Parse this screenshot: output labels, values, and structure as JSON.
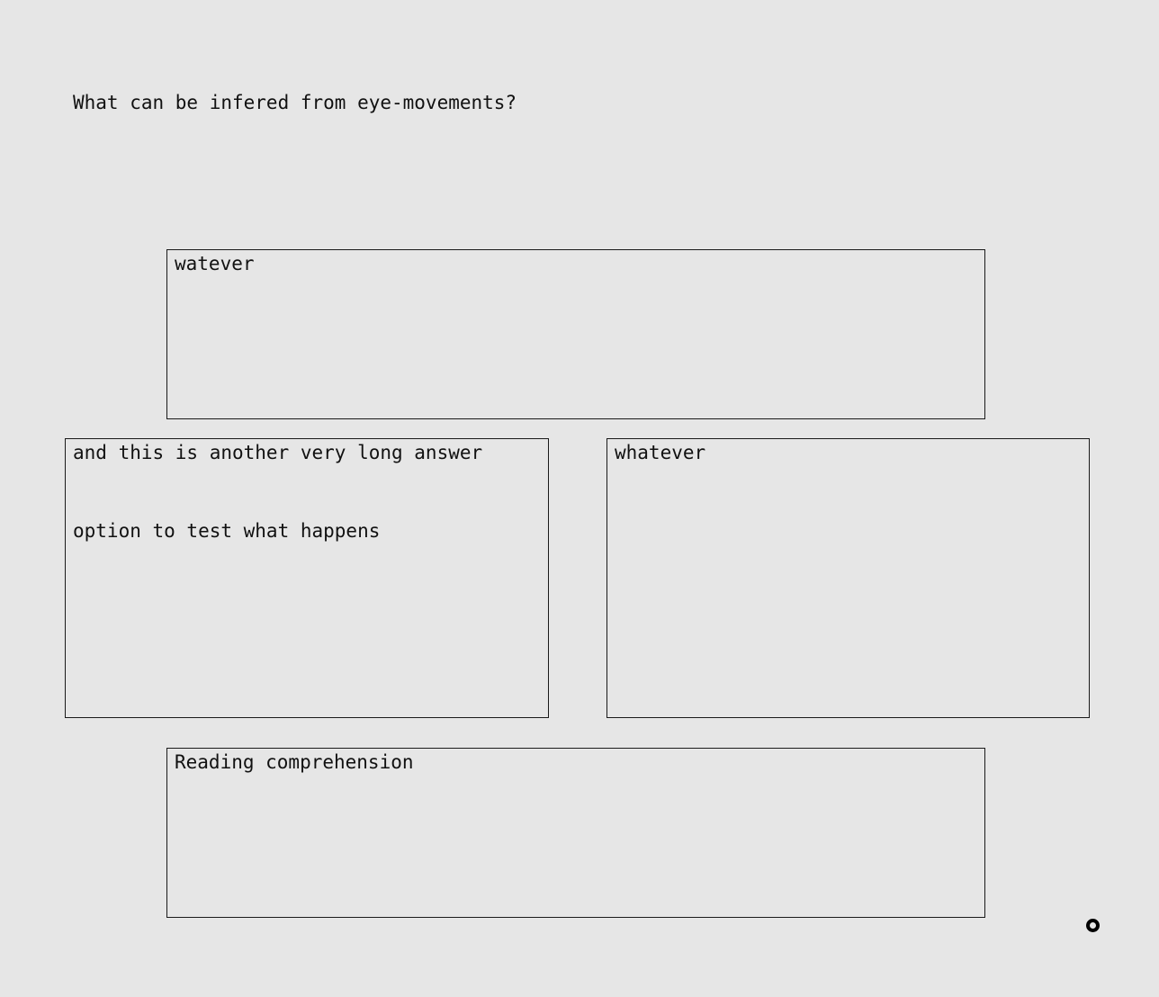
{
  "question": {
    "text": "What can be infered from eye-movements?"
  },
  "options": {
    "top": {
      "label": "watever"
    },
    "left": {
      "line1": "and this is another very long answer",
      "line2": "option to test what happens"
    },
    "right": {
      "label": "whatever"
    },
    "bottom": {
      "label": "Reading comprehension"
    }
  },
  "marker": {
    "icon": "gaze-cursor-icon"
  },
  "colors": {
    "background": "#e6e6e6",
    "border": "#1a1a1a",
    "text": "#111111"
  }
}
